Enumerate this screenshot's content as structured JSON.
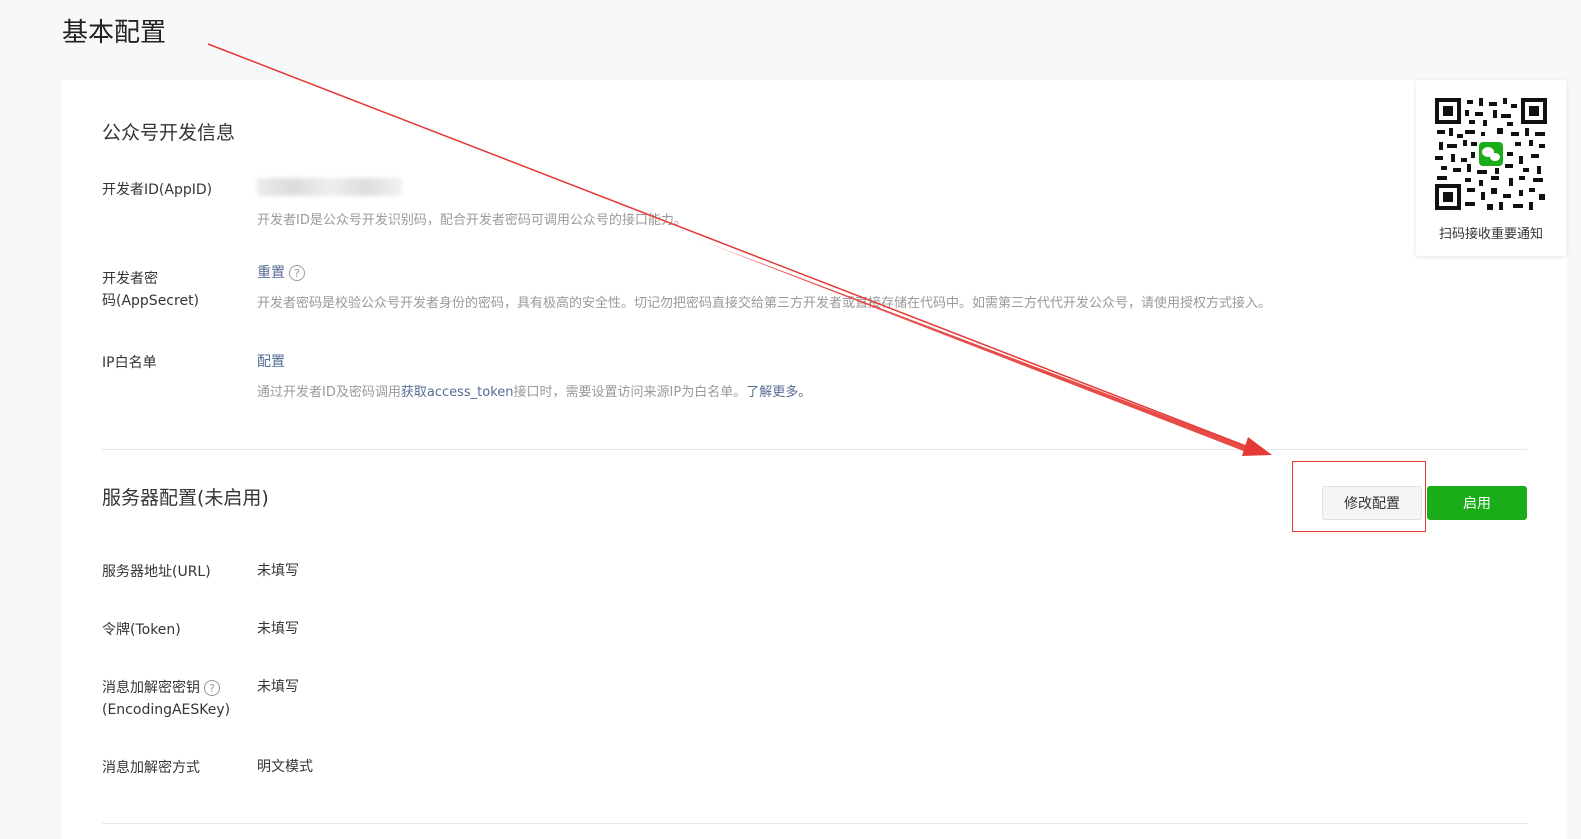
{
  "page": {
    "title": "基本配置"
  },
  "dev_info": {
    "section_title": "公众号开发信息",
    "appid": {
      "label": "开发者ID(AppID)",
      "desc": "开发者ID是公众号开发识别码，配合开发者密码可调用公众号的接口能力。"
    },
    "appsecret": {
      "label_line1": "开发者密",
      "label_line2": "码(AppSecret)",
      "action": "重置",
      "help": "?",
      "desc": "开发者密码是校验公众号开发者身份的密码，具有极高的安全性。切记勿把密码直接交给第三方开发者或直接存储在代码中。如需第三方代代开发公众号，请使用授权方式接入。"
    },
    "ip_whitelist": {
      "label": "IP白名单",
      "action": "配置",
      "desc_part1": "通过开发者ID及密码调用",
      "desc_link1": "获取access_token",
      "desc_part2": "接口时，需要设置访问来源IP为白名单。",
      "desc_link2": "了解更多。"
    }
  },
  "server_config": {
    "section_title": "服务器配置(未启用)",
    "modify_button": "修改配置",
    "enable_button": "启用",
    "url": {
      "label": "服务器地址(URL)",
      "value": "未填写"
    },
    "token": {
      "label": "令牌(Token)",
      "value": "未填写"
    },
    "aes_key": {
      "label_line1": "消息加解密密钥",
      "label_line2": "(EncodingAESKey)",
      "help": "?",
      "value": "未填写"
    },
    "encrypt_mode": {
      "label": "消息加解密方式",
      "value": "明文模式"
    }
  },
  "qr_panel": {
    "caption": "扫码接收重要通知"
  },
  "colors": {
    "primary_green": "#1aad19",
    "link_blue": "#576b95",
    "annotation_red": "#e53935"
  }
}
